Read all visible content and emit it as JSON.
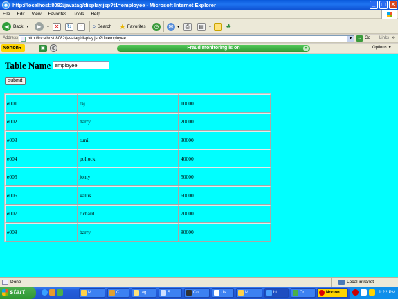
{
  "window": {
    "title": "http://localhost:8082/javatag/display.jsp?t1=employee - Microsoft Internet Explorer",
    "controls": [
      "minimize",
      "maximize",
      "close"
    ]
  },
  "menu": [
    "File",
    "Edit",
    "View",
    "Favorites",
    "Tools",
    "Help"
  ],
  "toolbar": {
    "back": "Back",
    "search": "Search",
    "favorites": "Favorites"
  },
  "address": {
    "label": "Address",
    "url": "http://localhost:8082/javatag/display.jsp?t1=employee",
    "go": "Go",
    "links": "Links"
  },
  "norton": {
    "logo": "Norton",
    "status": "Fraud monitoring is on",
    "options": "Options"
  },
  "form": {
    "label": "Table Name",
    "input_value": "employee",
    "submit": "submit"
  },
  "table": {
    "rows": [
      [
        "e001",
        "raj",
        "10000"
      ],
      [
        "e002",
        "harry",
        "20000"
      ],
      [
        "e003",
        "sunil",
        "30000"
      ],
      [
        "e004",
        "pollock",
        "40000"
      ],
      [
        "e005",
        "jonty",
        "50000"
      ],
      [
        "e006",
        "kallis",
        "60000"
      ],
      [
        "e007",
        "richard",
        "70000"
      ],
      [
        "e008",
        "barry",
        "80000"
      ]
    ]
  },
  "status": {
    "left": "Done",
    "zone": "Local intranet"
  },
  "taskbar": {
    "start": "start",
    "tasks": [
      "M...",
      "C...",
      "tag",
      "S...",
      "Co...",
      "Us...",
      "M...",
      "ht...",
      "Cr..."
    ],
    "active_task": 7,
    "tray_norton": "Norton",
    "clock": "1:22 PM"
  },
  "colors": {
    "page_background": "#00ffff",
    "title_bar": "#0a5adb",
    "norton_pill": "#3fb043",
    "taskbar": "#245edb",
    "start_button": "#3a9d3d"
  }
}
